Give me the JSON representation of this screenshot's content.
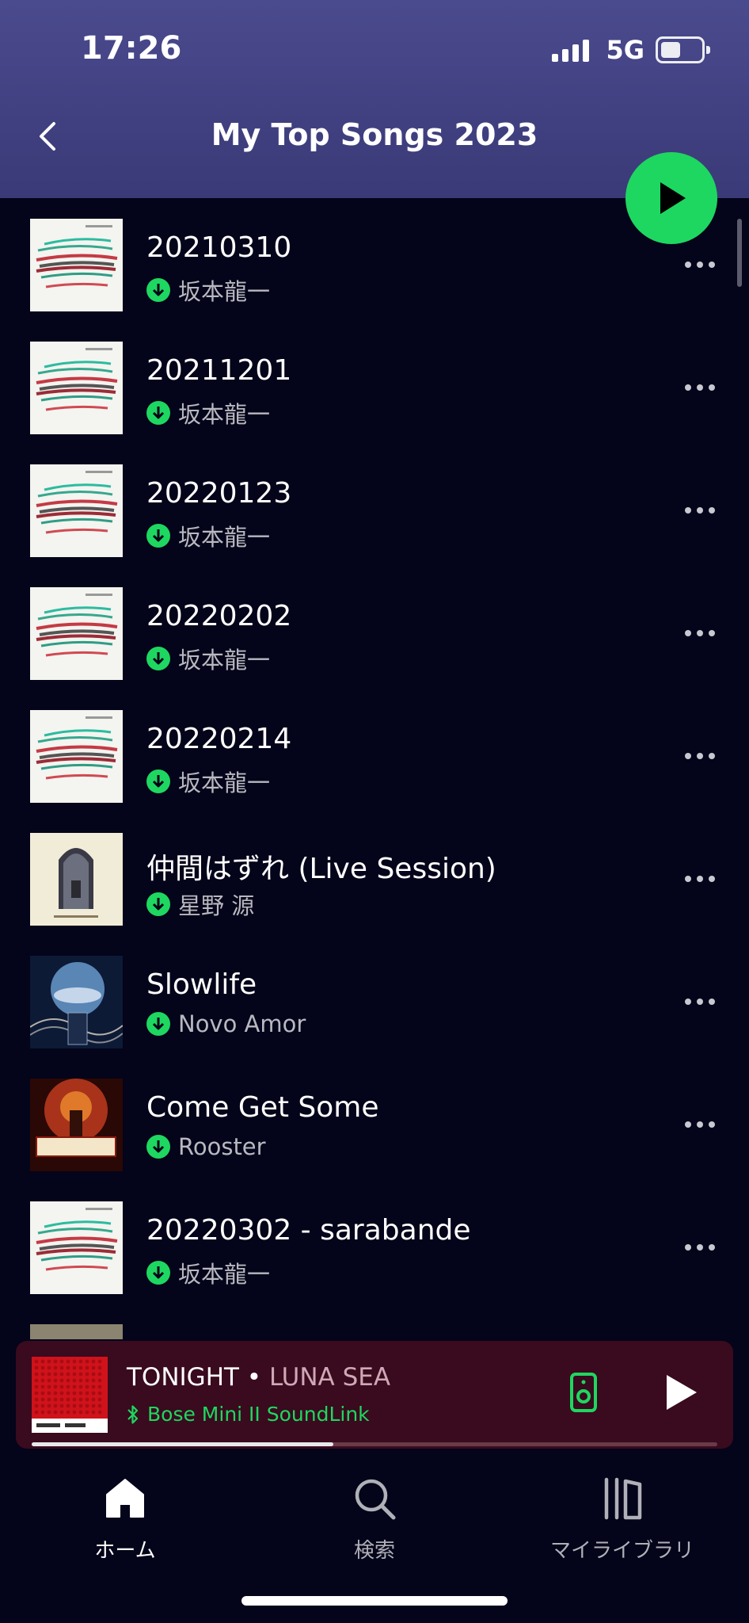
{
  "status_bar": {
    "time": "17:26",
    "network": "5G"
  },
  "header": {
    "title": "My Top Songs 2023"
  },
  "colors": {
    "accent": "#1ed760",
    "background": "#04041a",
    "header": "#3f3f80",
    "mini_player": "#3a0a1e"
  },
  "tracks": [
    {
      "title": "20210310",
      "artist": "坂本龍一",
      "downloaded": true,
      "art": "sakamoto"
    },
    {
      "title": "20211201",
      "artist": "坂本龍一",
      "downloaded": true,
      "art": "sakamoto"
    },
    {
      "title": "20220123",
      "artist": "坂本龍一",
      "downloaded": true,
      "art": "sakamoto"
    },
    {
      "title": "20220202",
      "artist": "坂本龍一",
      "downloaded": true,
      "art": "sakamoto"
    },
    {
      "title": "20220214",
      "artist": "坂本龍一",
      "downloaded": true,
      "art": "sakamoto"
    },
    {
      "title": "仲間はずれ (Live Session)",
      "artist": "星野 源",
      "downloaded": true,
      "art": "lighthouse"
    },
    {
      "title": "Slowlife",
      "artist": "Novo Amor",
      "downloaded": true,
      "art": "novo"
    },
    {
      "title": "Come Get Some",
      "artist": "Rooster",
      "downloaded": true,
      "art": "rooster"
    },
    {
      "title": "20220302 - sarabande",
      "artist": "坂本龍一",
      "downloaded": true,
      "art": "sakamoto"
    }
  ],
  "now_playing": {
    "title": "TONIGHT",
    "separator": " • ",
    "artist": "LUNA SEA",
    "device": "Bose Mini II SoundLink",
    "progress": 0.44
  },
  "nav": {
    "items": [
      {
        "label": "ホーム",
        "icon": "home-icon",
        "active": true
      },
      {
        "label": "検索",
        "icon": "search-icon",
        "active": false
      },
      {
        "label": "マイライブラリ",
        "icon": "library-icon",
        "active": false
      }
    ]
  }
}
